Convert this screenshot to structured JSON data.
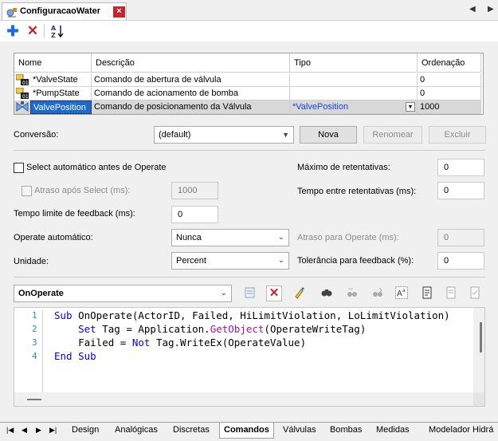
{
  "window": {
    "title": "ConfiguracaoWater"
  },
  "grid": {
    "headers": [
      "Nome",
      "Descrição",
      "Tipo",
      "Ordenação"
    ],
    "rows": [
      {
        "name": "*ValveState",
        "description": "Comando de abertura de válvula",
        "type": "",
        "order": "0"
      },
      {
        "name": "*PumpState",
        "description": "Comando de acionamento de bomba",
        "type": "",
        "order": "0"
      },
      {
        "name": "ValvePosition",
        "description": "Comando de posicionamento da Válvula",
        "type": "*ValvePosition",
        "order": "1000"
      }
    ]
  },
  "conversion": {
    "label": "Conversão:",
    "value": "(default)",
    "new_label": "Nova",
    "rename_label": "Renomear",
    "delete_label": "Excluir"
  },
  "form": {
    "select_auto_label": "Select automático antes de Operate",
    "delay_after_select_label": "Atraso após Select (ms):",
    "delay_after_select_value": "1000",
    "feedback_timeout_label": "Tempo limite de feedback (ms):",
    "feedback_timeout_value": "0",
    "operate_auto_label": "Operate automático:",
    "operate_auto_value": "Nunca",
    "unit_label": "Unidade:",
    "unit_value": "Percent",
    "max_retries_label": "Máximo de retentativas:",
    "max_retries_value": "0",
    "retry_time_label": "Tempo entre retentativas (ms):",
    "retry_time_value": "0",
    "operate_delay_label": "Atraso para Operate (ms):",
    "operate_delay_value": "0",
    "feedback_tolerance_label": "Tolerância para feedback (%):",
    "feedback_tolerance_value": "0"
  },
  "script": {
    "event": "OnOperate",
    "line_numbers": [
      "1",
      "2",
      "3",
      "4"
    ]
  },
  "tabs": [
    "Design",
    "Analógicas",
    "Discretas",
    "Comandos",
    "Válvulas",
    "Bombas",
    "Medidas",
    "Modelador Hidrá"
  ],
  "active_tab": "Comandos",
  "colors": {
    "accent": "#1b6bd1",
    "close": "#c2272d",
    "keyword": "#0000ff",
    "function": "#a31597",
    "line_number": "#2b91af"
  }
}
